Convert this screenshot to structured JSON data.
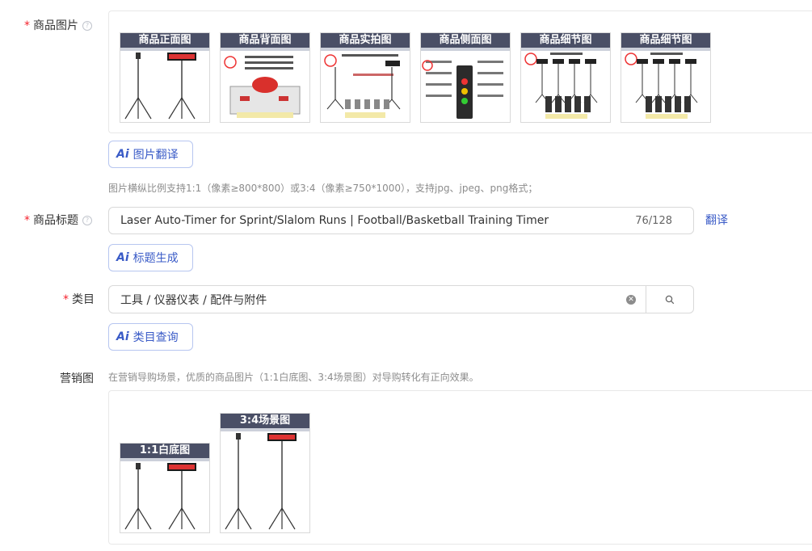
{
  "images": {
    "label": "商品图片",
    "items": [
      {
        "caption": "商品正面图"
      },
      {
        "caption": "商品背面图"
      },
      {
        "caption": "商品实拍图"
      },
      {
        "caption": "商品侧面图"
      },
      {
        "caption": "商品细节图"
      },
      {
        "caption": "商品细节图"
      }
    ],
    "translate_button": "图片翻译",
    "hint": "图片横纵比例支持1:1（像素≥800*800）或3:4（像素≥750*1000），支持jpg、jpeg、png格式；"
  },
  "title": {
    "label": "商品标题",
    "value": "Laser Auto-Timer for Sprint/Slalom Runs | Football/Basketball Training Timer",
    "counter": "76/128",
    "translate_link": "翻译",
    "generate_button": "标题生成"
  },
  "category": {
    "label": "类目",
    "value": "工具 / 仪器仪表 / 配件与附件",
    "query_button": "类目查询"
  },
  "marketing": {
    "label": "营销图",
    "hint": "在营销导购场景，优质的商品图片（1:1白底图、3:4场景图）对导购转化有正向效果。",
    "items": [
      {
        "caption": "1:1白底图"
      },
      {
        "caption": "3:4场景图"
      }
    ]
  },
  "icons": {
    "ai": "Ai"
  }
}
